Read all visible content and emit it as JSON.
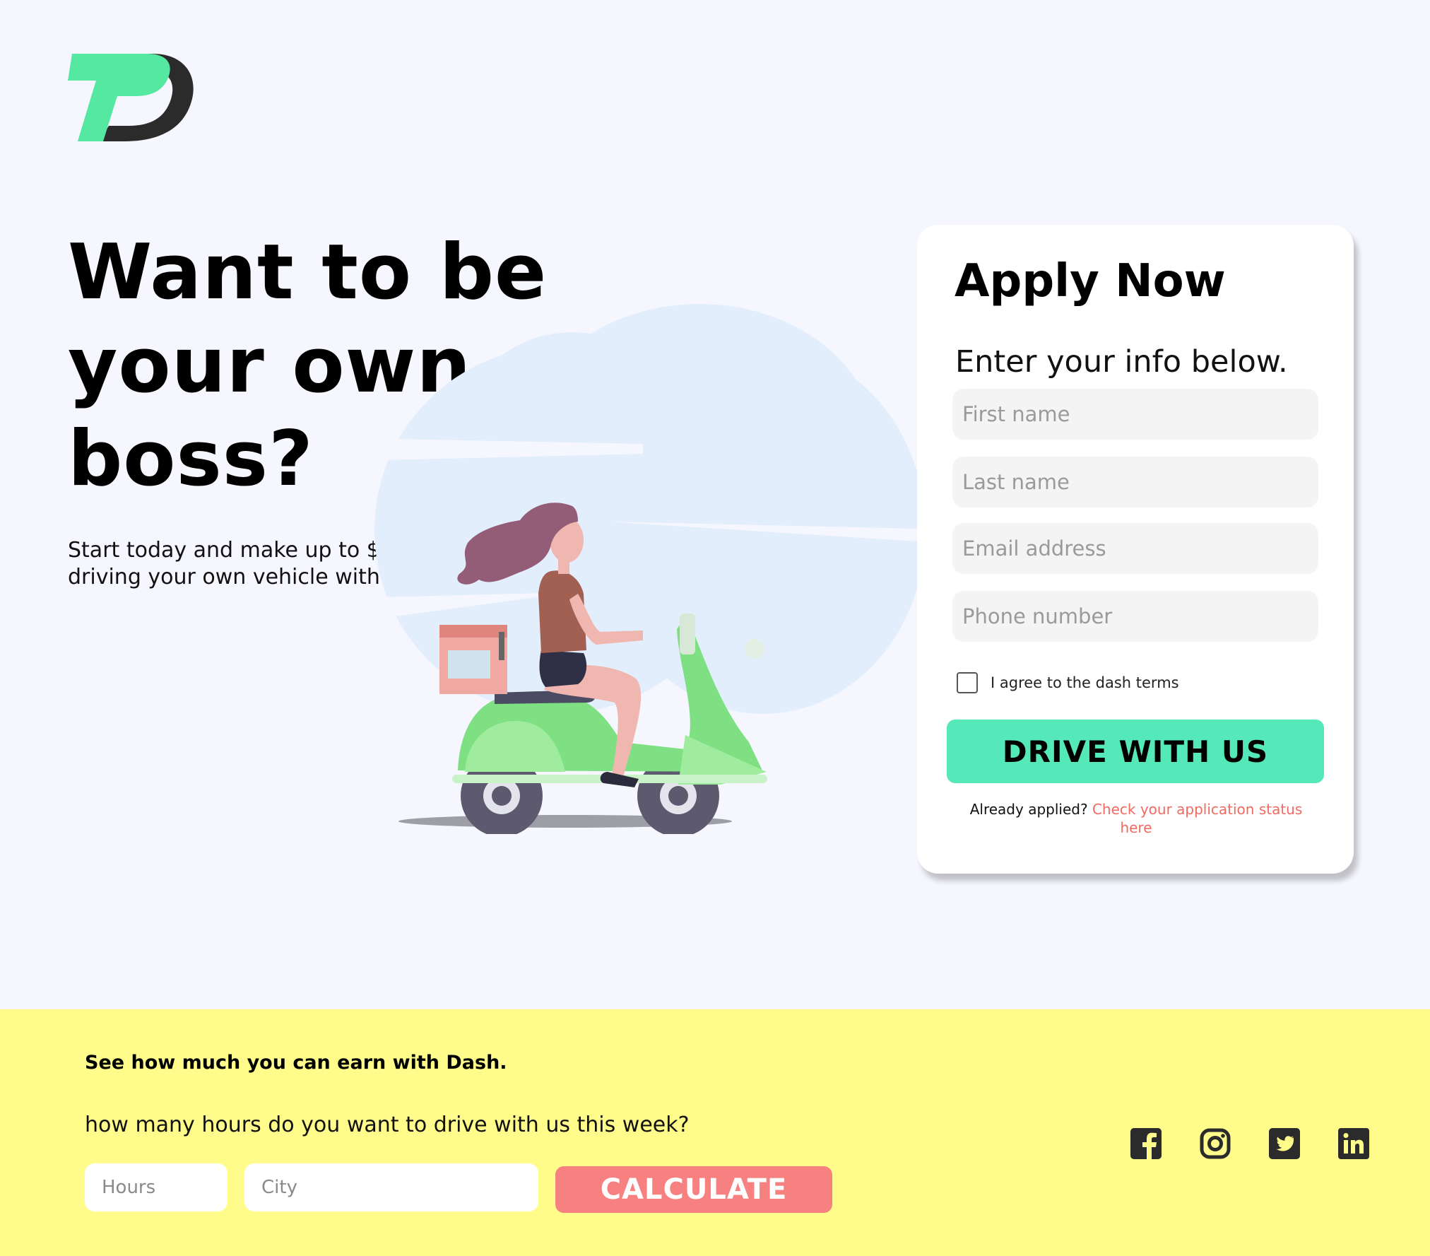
{
  "hero": {
    "title": "Want to be your own boss?",
    "subtitle": "Start today and make up to $30/hr driving your own vehicle with Dash!"
  },
  "apply": {
    "title": "Apply Now",
    "subtitle": "Enter your info below.",
    "fields": {
      "first_name": "First name",
      "last_name": "Last name",
      "email": "Email address",
      "phone": "Phone number"
    },
    "terms_label": "I agree to the dash terms",
    "submit_label": "DRIVE WITH US",
    "status_prefix": "Already applied?",
    "status_link": "Check your application status here"
  },
  "calculator": {
    "title": "See how much you can earn with Dash.",
    "question": "how many hours do you want to drive with us this week?",
    "hours_placeholder": "Hours",
    "city_placeholder": "City",
    "button_label": "CALCULATE"
  },
  "social": [
    "facebook-icon",
    "instagram-icon",
    "twitter-icon",
    "linkedin-icon"
  ],
  "colors": {
    "background": "#f6f7fe",
    "brand_green": "#55e8b9",
    "footer_yellow": "#fffc8b",
    "calculate_red": "#f78080",
    "link_red": "#f06a62",
    "icon_dark": "#2b2b2b"
  }
}
